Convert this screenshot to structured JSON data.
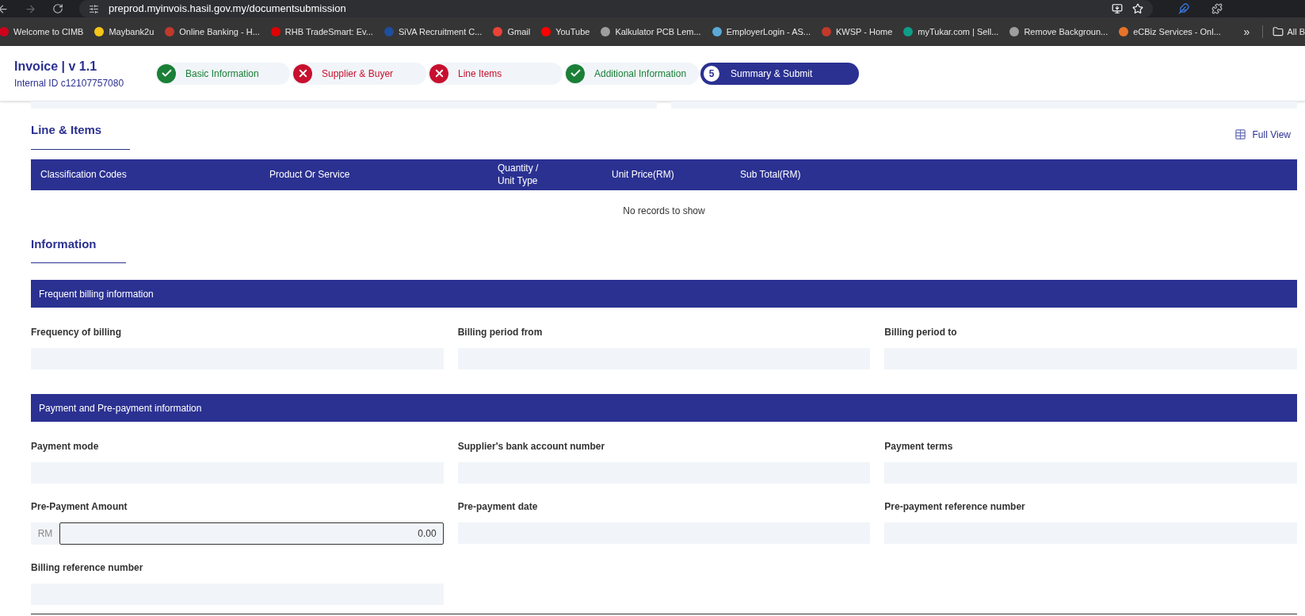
{
  "browser": {
    "url": "preprod.myinvois.hasil.gov.my/documentsubmission",
    "bookmarks": [
      {
        "label": "Welcome to CIMB",
        "color": "#d0021b"
      },
      {
        "label": "Maybank2u",
        "color": "#f5c518"
      },
      {
        "label": "Online Banking - H...",
        "color": "#c0392b"
      },
      {
        "label": "RHB TradeSmart: Ev...",
        "color": "#e00000"
      },
      {
        "label": "SiVA Recruitment C...",
        "color": "#1f4e9c"
      },
      {
        "label": "Gmail",
        "color": "#ea4335"
      },
      {
        "label": "YouTube",
        "color": "#ff0000"
      },
      {
        "label": "Kalkulator PCB Lem...",
        "color": "#9e9e9e"
      },
      {
        "label": "EmployerLogin - AS...",
        "color": "#5aa9d6"
      },
      {
        "label": "KWSP - Home",
        "color": "#c0392b"
      },
      {
        "label": "myTukar.com | Sell...",
        "color": "#0f9d8a"
      },
      {
        "label": "Remove Backgroun...",
        "color": "#9e9e9e"
      },
      {
        "label": "eCBiz Services - Onl...",
        "color": "#e8742a"
      }
    ],
    "more": "»",
    "all_bookmarks": "All B"
  },
  "header": {
    "title": "Invoice | v 1.1",
    "internal_id": "Internal ID c12107757080"
  },
  "steps": [
    {
      "label": "Basic Information",
      "kind": "done",
      "selected": false
    },
    {
      "label": "Supplier & Buyer",
      "kind": "error",
      "selected": false
    },
    {
      "label": "Line Items",
      "kind": "error",
      "selected": false
    },
    {
      "label": "Additional Information",
      "kind": "done",
      "selected": false
    },
    {
      "label": "Summary & Submit",
      "kind": "current",
      "number": "5",
      "selected": true
    }
  ],
  "line_items": {
    "title": "Line & Items",
    "full_view": "Full View",
    "columns": [
      "Classification Codes",
      "Product Or Service",
      "Quantity /\nUnit Type",
      "Unit Price(RM)",
      "Sub Total(RM)"
    ],
    "empty": "No records to show"
  },
  "information": {
    "title": "Information",
    "sections": [
      {
        "title": "Frequent billing information",
        "fields": [
          {
            "label": "Frequency of billing",
            "kind": "plain"
          },
          {
            "label": "Billing period from",
            "kind": "plain"
          },
          {
            "label": "Billing period to",
            "kind": "plain"
          }
        ]
      },
      {
        "title": "Payment and Pre-payment information",
        "fields": [
          {
            "label": "Payment mode",
            "kind": "plain"
          },
          {
            "label": "Supplier's bank account number",
            "kind": "plain"
          },
          {
            "label": "Payment terms",
            "kind": "plain"
          },
          {
            "label": "Pre-Payment Amount",
            "kind": "currency",
            "prefix": "RM",
            "value": "0.00"
          },
          {
            "label": "Pre-payment date",
            "kind": "plain"
          },
          {
            "label": "Pre-payment reference number",
            "kind": "plain"
          },
          {
            "label": "Billing reference number",
            "kind": "plain"
          }
        ]
      }
    ]
  }
}
